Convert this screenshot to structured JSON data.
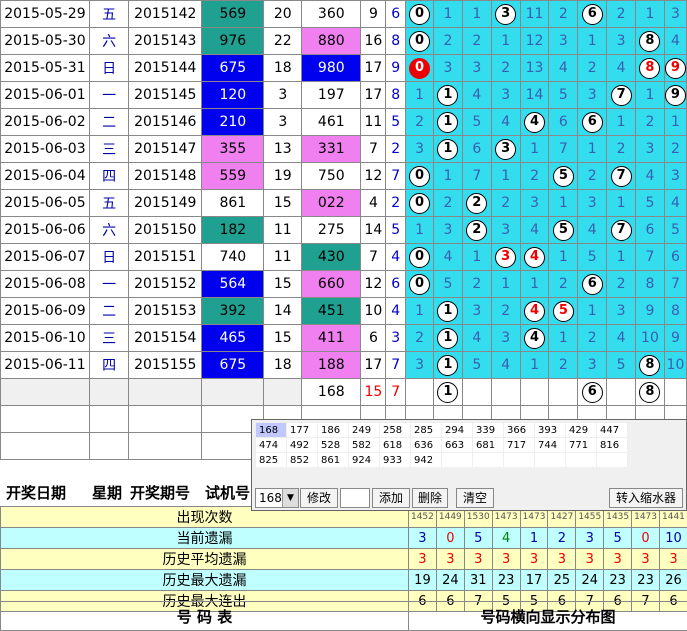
{
  "rows": [
    {
      "date": "2015-05-29",
      "wk": "五",
      "issue": "2015142",
      "trial": "569",
      "tc": "teal",
      "s": "20",
      "draw": "360",
      "dc": "",
      "a": "9",
      "b": "6",
      "cells": [
        "b0",
        "1",
        "1",
        "b3",
        "11",
        "2",
        "b6",
        "2",
        "1",
        "3"
      ]
    },
    {
      "date": "2015-05-30",
      "wk": "六",
      "issue": "2015143",
      "trial": "976",
      "tc": "teal",
      "s": "22",
      "draw": "880",
      "dc": "pink",
      "a": "16",
      "b": "8",
      "cells": [
        "b0",
        "2",
        "2",
        "1",
        "12",
        "3",
        "1",
        "3",
        "b8",
        "4"
      ]
    },
    {
      "date": "2015-05-31",
      "wk": "日",
      "issue": "2015144",
      "trial": "675",
      "tc": "blue",
      "s": "18",
      "draw": "980",
      "dc": "blue",
      "a": "17",
      "b": "9",
      "cells": [
        "rf0",
        "3",
        "3",
        "2",
        "13",
        "4",
        "2",
        "4",
        "r8",
        "r9"
      ]
    },
    {
      "date": "2015-06-01",
      "wk": "一",
      "issue": "2015145",
      "trial": "120",
      "tc": "blue",
      "s": "3",
      "draw": "197",
      "dc": "",
      "a": "17",
      "b": "8",
      "cells": [
        "1",
        "b1",
        "4",
        "3",
        "14",
        "5",
        "3",
        "b7",
        "1",
        "b9"
      ]
    },
    {
      "date": "2015-06-02",
      "wk": "二",
      "issue": "2015146",
      "trial": "210",
      "tc": "blue",
      "s": "3",
      "draw": "461",
      "dc": "",
      "a": "11",
      "b": "5",
      "cells": [
        "2",
        "b1",
        "5",
        "4",
        "b4",
        "6",
        "b6",
        "1",
        "2",
        "1"
      ]
    },
    {
      "date": "2015-06-03",
      "wk": "三",
      "issue": "2015147",
      "trial": "355",
      "tc": "pink",
      "s": "13",
      "draw": "331",
      "dc": "pink",
      "a": "7",
      "b": "2",
      "cells": [
        "3",
        "b1",
        "6",
        "b3",
        "1",
        "7",
        "1",
        "2",
        "3",
        "2"
      ]
    },
    {
      "date": "2015-06-04",
      "wk": "四",
      "issue": "2015148",
      "trial": "559",
      "tc": "pink",
      "s": "19",
      "draw": "750",
      "dc": "",
      "a": "12",
      "b": "7",
      "cells": [
        "b0",
        "1",
        "7",
        "1",
        "2",
        "b5",
        "2",
        "b7",
        "4",
        "3"
      ]
    },
    {
      "date": "2015-06-05",
      "wk": "五",
      "issue": "2015149",
      "trial": "861",
      "tc": "",
      "s": "15",
      "draw": "022",
      "dc": "pink",
      "a": "4",
      "b": "2",
      "cells": [
        "b0",
        "2",
        "b2",
        "2",
        "3",
        "1",
        "3",
        "1",
        "5",
        "4"
      ]
    },
    {
      "date": "2015-06-06",
      "wk": "六",
      "issue": "2015150",
      "trial": "182",
      "tc": "teal",
      "s": "11",
      "draw": "275",
      "dc": "",
      "a": "14",
      "b": "5",
      "cells": [
        "1",
        "3",
        "b2",
        "3",
        "4",
        "b5",
        "4",
        "b7",
        "6",
        "5"
      ]
    },
    {
      "date": "2015-06-07",
      "wk": "日",
      "issue": "2015151",
      "trial": "740",
      "tc": "",
      "s": "11",
      "draw": "430",
      "dc": "teal",
      "a": "7",
      "b": "4",
      "cells": [
        "b0",
        "4",
        "1",
        "r3",
        "r4",
        "1",
        "5",
        "1",
        "7",
        "6"
      ]
    },
    {
      "date": "2015-06-08",
      "wk": "一",
      "issue": "2015152",
      "trial": "564",
      "tc": "blue",
      "s": "15",
      "draw": "660",
      "dc": "pink",
      "a": "12",
      "b": "6",
      "cells": [
        "b0",
        "5",
        "2",
        "1",
        "1",
        "2",
        "b6",
        "2",
        "8",
        "7"
      ]
    },
    {
      "date": "2015-06-09",
      "wk": "二",
      "issue": "2015153",
      "trial": "392",
      "tc": "teal",
      "s": "14",
      "draw": "451",
      "dc": "teal",
      "a": "10",
      "b": "4",
      "cells": [
        "1",
        "b1",
        "3",
        "2",
        "r4",
        "r5",
        "1",
        "3",
        "9",
        "8"
      ]
    },
    {
      "date": "2015-06-10",
      "wk": "三",
      "issue": "2015154",
      "trial": "465",
      "tc": "blue",
      "s": "15",
      "draw": "411",
      "dc": "pink",
      "a": "6",
      "b": "3",
      "cells": [
        "2",
        "b1",
        "4",
        "3",
        "b4",
        "1",
        "2",
        "4",
        "10",
        "9"
      ]
    },
    {
      "date": "2015-06-11",
      "wk": "四",
      "issue": "2015155",
      "trial": "675",
      "tc": "blue",
      "s": "18",
      "draw": "188",
      "dc": "pink",
      "a": "17",
      "b": "7",
      "cells": [
        "3",
        "b1",
        "5",
        "4",
        "1",
        "2",
        "3",
        "5",
        "b8",
        "10"
      ]
    }
  ],
  "summary": {
    "draw": "168",
    "a": "15",
    "b": "7",
    "balls": [
      "",
      "1",
      "",
      "",
      "",
      "",
      "6",
      "",
      "8",
      ""
    ]
  },
  "popup": {
    "numbers": [
      [
        "168",
        "177",
        "186",
        "249",
        "258",
        "285",
        "294",
        "339",
        "366",
        "393",
        "429",
        "447"
      ],
      [
        "474",
        "492",
        "528",
        "582",
        "618",
        "636",
        "663",
        "681",
        "717",
        "744",
        "771",
        "816"
      ],
      [
        "825",
        "852",
        "861",
        "924",
        "933",
        "942",
        "",
        "",
        "",
        "",
        "",
        ""
      ]
    ],
    "select": "168",
    "modify": "修改",
    "add": "添加",
    "delete": "删除",
    "clear": "清空",
    "shrink": "转入缩水器"
  },
  "header": {
    "date": "开奖日期",
    "week": "星期",
    "issue": "开奖期号",
    "trial": "试机号"
  },
  "stats": [
    {
      "label": "出现次数",
      "vals": [
        "1452",
        "1449",
        "1530",
        "1473",
        "1473",
        "1427",
        "1455",
        "1435",
        "1473",
        "1441"
      ]
    },
    {
      "label": "当前遗漏",
      "vals": [
        "3",
        "0",
        "5",
        "4",
        "1",
        "2",
        "3",
        "5",
        "0",
        "10"
      ]
    },
    {
      "label": "历史平均遗漏",
      "vals": [
        "3",
        "3",
        "3",
        "3",
        "3",
        "3",
        "3",
        "3",
        "3",
        "3"
      ]
    },
    {
      "label": "历史最大遗漏",
      "vals": [
        "19",
        "24",
        "31",
        "23",
        "17",
        "25",
        "24",
        "23",
        "23",
        "26"
      ]
    },
    {
      "label": "历史最大连出",
      "vals": [
        "6",
        "6",
        "7",
        "5",
        "5",
        "6",
        "7",
        "6",
        "7",
        "6"
      ]
    }
  ],
  "footer": {
    "left": "号 码 表",
    "right": "号码横向显示分布图"
  }
}
